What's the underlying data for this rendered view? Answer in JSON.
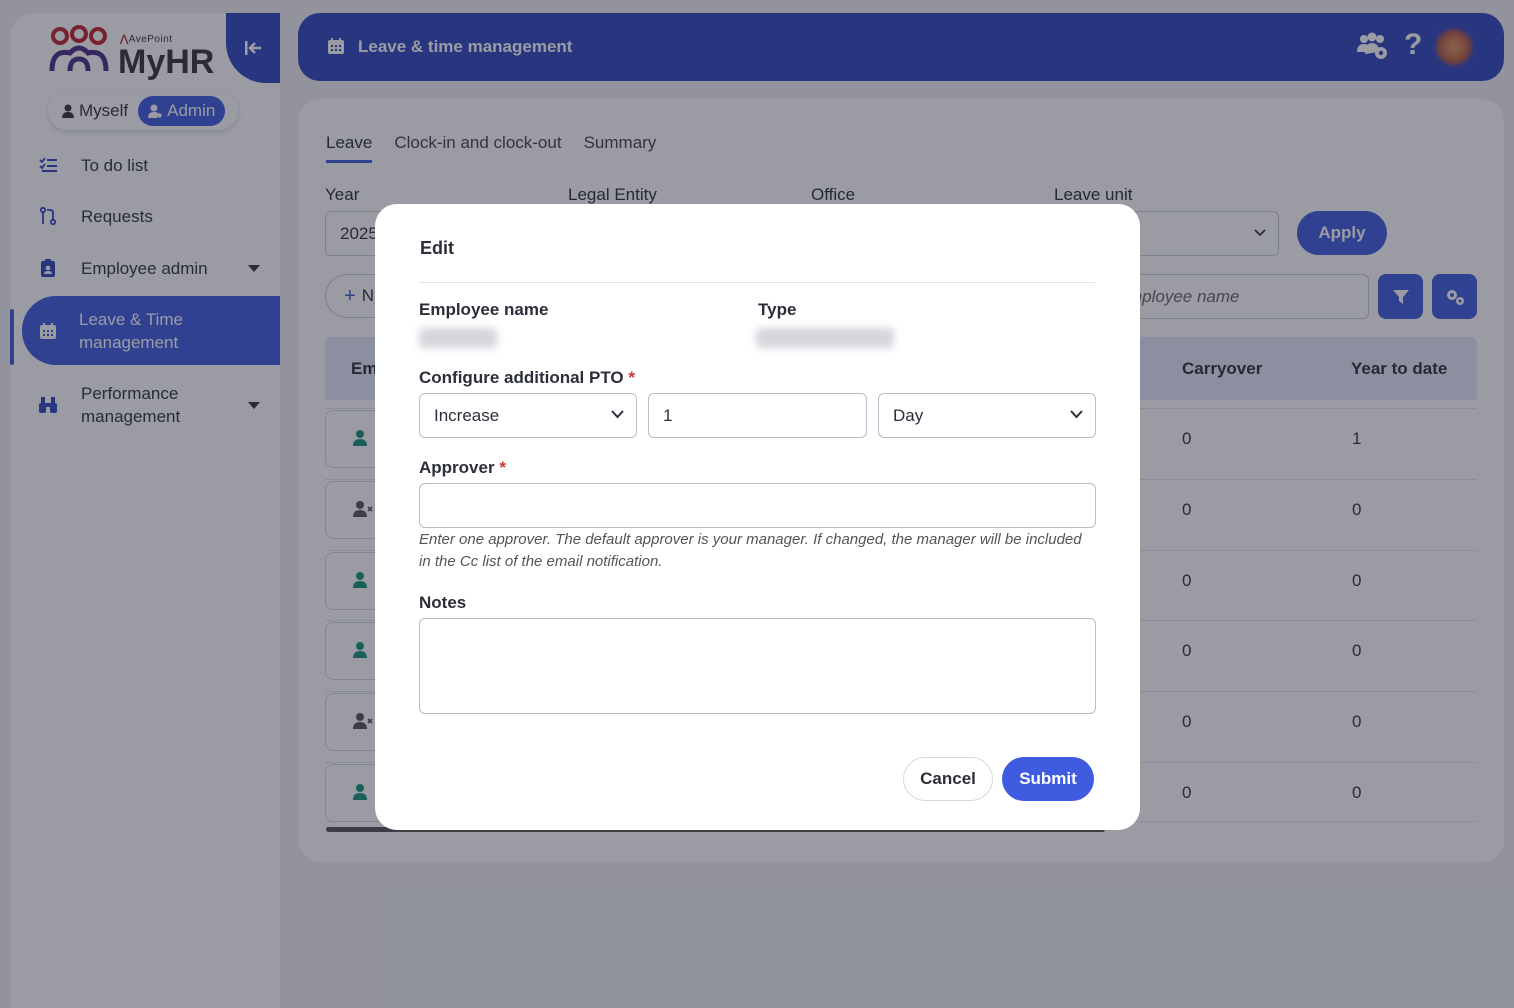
{
  "app": {
    "brand": "AvePoint",
    "name": "MyHR"
  },
  "roles": {
    "myself": "Myself",
    "admin": "Admin"
  },
  "sidebar": {
    "items": [
      {
        "label": "To do list"
      },
      {
        "label": "Requests"
      },
      {
        "label": "Employee admin"
      },
      {
        "label": "Leave & Time management"
      },
      {
        "label": "Performance management"
      }
    ]
  },
  "header": {
    "title": "Leave & time management"
  },
  "tabs": [
    "Leave",
    "Clock-in and clock-out",
    "Summary"
  ],
  "filters": {
    "year_label": "Year",
    "year_value": "2025",
    "legal_entity_label": "Legal Entity",
    "office_label": "Office",
    "leave_unit_label": "Leave unit",
    "apply": "Apply",
    "new_button": "N",
    "search_placeholder": "mployee name"
  },
  "table": {
    "columns": {
      "first": "Em",
      "carryover": "Carryover",
      "ytd": "Year to date"
    },
    "rows": [
      {
        "carryover": "0",
        "ytd": "1"
      },
      {
        "carryover": "0",
        "ytd": "0"
      },
      {
        "carryover": "0",
        "ytd": "0"
      },
      {
        "carryover": "0",
        "ytd": "0"
      },
      {
        "carryover": "0",
        "ytd": "0"
      },
      {
        "carryover": "0",
        "ytd": "0"
      }
    ]
  },
  "modal": {
    "title": "Edit",
    "employee_name_label": "Employee name",
    "type_label": "Type",
    "pto_label": "Configure additional PTO",
    "pto_action": "Increase",
    "pto_amount": "1",
    "pto_unit": "Day",
    "approver_label": "Approver",
    "required_mark": "*",
    "hint": "Enter one approver. The default approver is your manager. If changed, the manager will be included in the Cc list of the email notification.",
    "notes_label": "Notes",
    "cancel": "Cancel",
    "submit": "Submit"
  },
  "colors": {
    "primary": "#3148c0",
    "accent": "#3f5bdf",
    "required": "#d13438",
    "user_icon": "#16937a"
  }
}
